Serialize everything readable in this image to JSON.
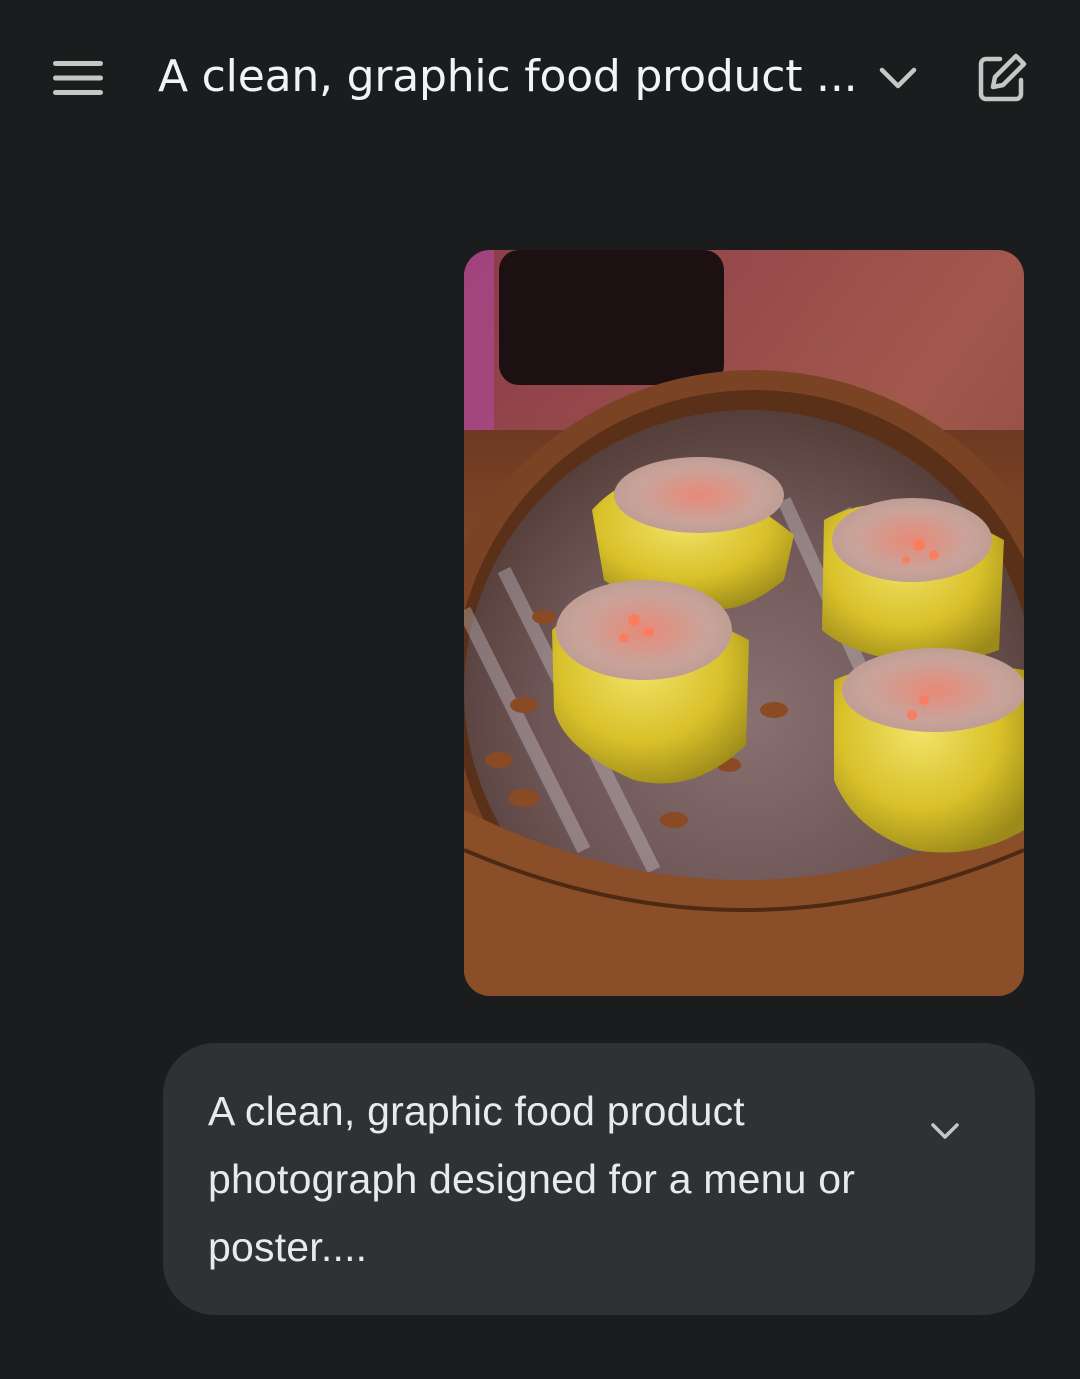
{
  "header": {
    "title": "A clean, graphic food product ...",
    "menu_icon": "hamburger-menu-icon",
    "expand_icon": "chevron-down-icon",
    "new_chat_icon": "edit-square-icon"
  },
  "message": {
    "image_icon": "photo-dumplings",
    "prompt_text": "A clean, graphic food product photograph designed for a menu or poster....",
    "expand_icon": "chevron-down-icon"
  },
  "colors": {
    "background": "#1b1c1e",
    "bubble": "#303134",
    "text": "#e8eaed"
  }
}
